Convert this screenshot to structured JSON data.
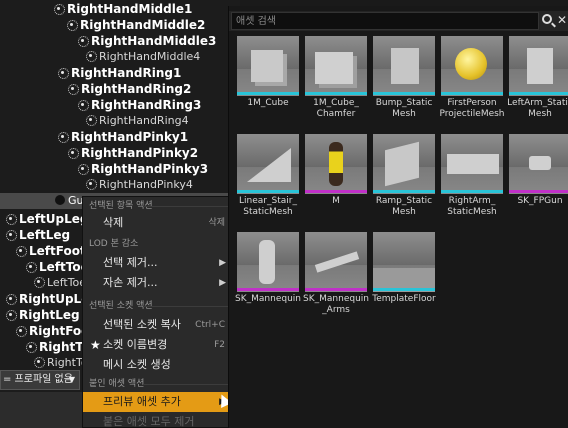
{
  "tree": {
    "bones": [
      {
        "label": "RightHandMiddle1",
        "leaf": false
      },
      {
        "label": "RightHandMiddle2",
        "leaf": false
      },
      {
        "label": "RightHandMiddle3",
        "leaf": false
      },
      {
        "label": "RightHandMiddle4",
        "leaf": true
      },
      {
        "label": "RightHandRing1",
        "leaf": false
      },
      {
        "label": "RightHandRing2",
        "leaf": false
      },
      {
        "label": "RightHandRing3",
        "leaf": false
      },
      {
        "label": "RightHandRing4",
        "leaf": true
      },
      {
        "label": "RightHandPinky1",
        "leaf": false
      },
      {
        "label": "RightHandPinky2",
        "leaf": false
      },
      {
        "label": "RightHandPinky3",
        "leaf": false
      },
      {
        "label": "RightHandPinky4",
        "leaf": true
      },
      {
        "label": "LeftUpLeg",
        "leaf": false
      },
      {
        "label": "LeftLeg",
        "leaf": false
      },
      {
        "label": "LeftFoot",
        "leaf": false
      },
      {
        "label": "LeftToeBa",
        "leaf": false
      },
      {
        "label": "LeftToe_E",
        "leaf": true
      },
      {
        "label": "RightUpLeg",
        "leaf": false
      },
      {
        "label": "RightLeg",
        "leaf": false
      },
      {
        "label": "RightFoot",
        "leaf": false
      },
      {
        "label": "RightToeE",
        "leaf": false
      },
      {
        "label": "RightToe",
        "leaf": true
      }
    ],
    "mesh_header": "Gu",
    "profile_dropdown": "= 프로파일 없음"
  },
  "context_menu": {
    "sections": [
      {
        "title": "선택된 항목 액션"
      },
      {
        "title": "LOD 본 감소"
      },
      {
        "title": "선택된 소켓 액션"
      },
      {
        "title": "붙인 애셋 액션"
      }
    ],
    "items": [
      {
        "label": "삭제",
        "shortcut": "삭제",
        "submenu": false,
        "highlighted": false,
        "disabled": false
      },
      {
        "label": "선택 제거...",
        "shortcut": "",
        "submenu": true,
        "highlighted": false,
        "disabled": false
      },
      {
        "label": "자손 제거...",
        "shortcut": "",
        "submenu": true,
        "highlighted": false,
        "disabled": false
      },
      {
        "label": "선택된 소켓 복사",
        "shortcut": "Ctrl+C",
        "submenu": false,
        "highlighted": false,
        "disabled": false
      },
      {
        "label": "소켓 이름변경",
        "shortcut": "F2",
        "submenu": false,
        "highlighted": false,
        "disabled": false
      },
      {
        "label": "메시 소켓 생성",
        "shortcut": "",
        "submenu": false,
        "highlighted": false,
        "disabled": false
      },
      {
        "label": "프리뷰 애셋 추가",
        "shortcut": "",
        "submenu": true,
        "highlighted": true,
        "disabled": false
      },
      {
        "label": "붙은 애셋 모두 제거",
        "shortcut": "",
        "submenu": false,
        "highlighted": false,
        "disabled": true
      }
    ],
    "highlight_color": "#e49b15"
  },
  "asset_picker": {
    "search_placeholder": "애셋 검색",
    "tiles": [
      {
        "label": "1M_Cube",
        "shape": "cube",
        "strip": "#29c4d8"
      },
      {
        "label": "1M_Cube_ Chamfer",
        "shape": "cube2",
        "strip": "#29c4d8"
      },
      {
        "label": "Bump_Static Mesh",
        "shape": "bump",
        "strip": "#29c4d8"
      },
      {
        "label": "FirstPerson ProjectileMesh",
        "shape": "sphere",
        "strip": "#29c4d8"
      },
      {
        "label": "LeftArm_Static Mesh",
        "shape": "arm",
        "strip": "#29c4d8"
      },
      {
        "label": "Linear_Stair_ StaticMesh",
        "shape": "ramp",
        "strip": "#29c4d8"
      },
      {
        "label": "M",
        "shape": "mannequin-y",
        "strip": "#c030c8"
      },
      {
        "label": "Ramp_Static Mesh",
        "shape": "ramp2",
        "strip": "#29c4d8"
      },
      {
        "label": "RightArm_ StaticMesh",
        "shape": "beam",
        "strip": "#29c4d8"
      },
      {
        "label": "SK_FPGun",
        "shape": "gun",
        "strip": "#c030c8"
      },
      {
        "label": "SK_Mannequin",
        "shape": "mannequin",
        "strip": "#c030c8"
      },
      {
        "label": "SK_Mannequin _Arms",
        "shape": "arms",
        "strip": "#c030c8"
      },
      {
        "label": "TemplateFloor",
        "shape": "floor",
        "strip": "#29c4d8"
      }
    ]
  }
}
